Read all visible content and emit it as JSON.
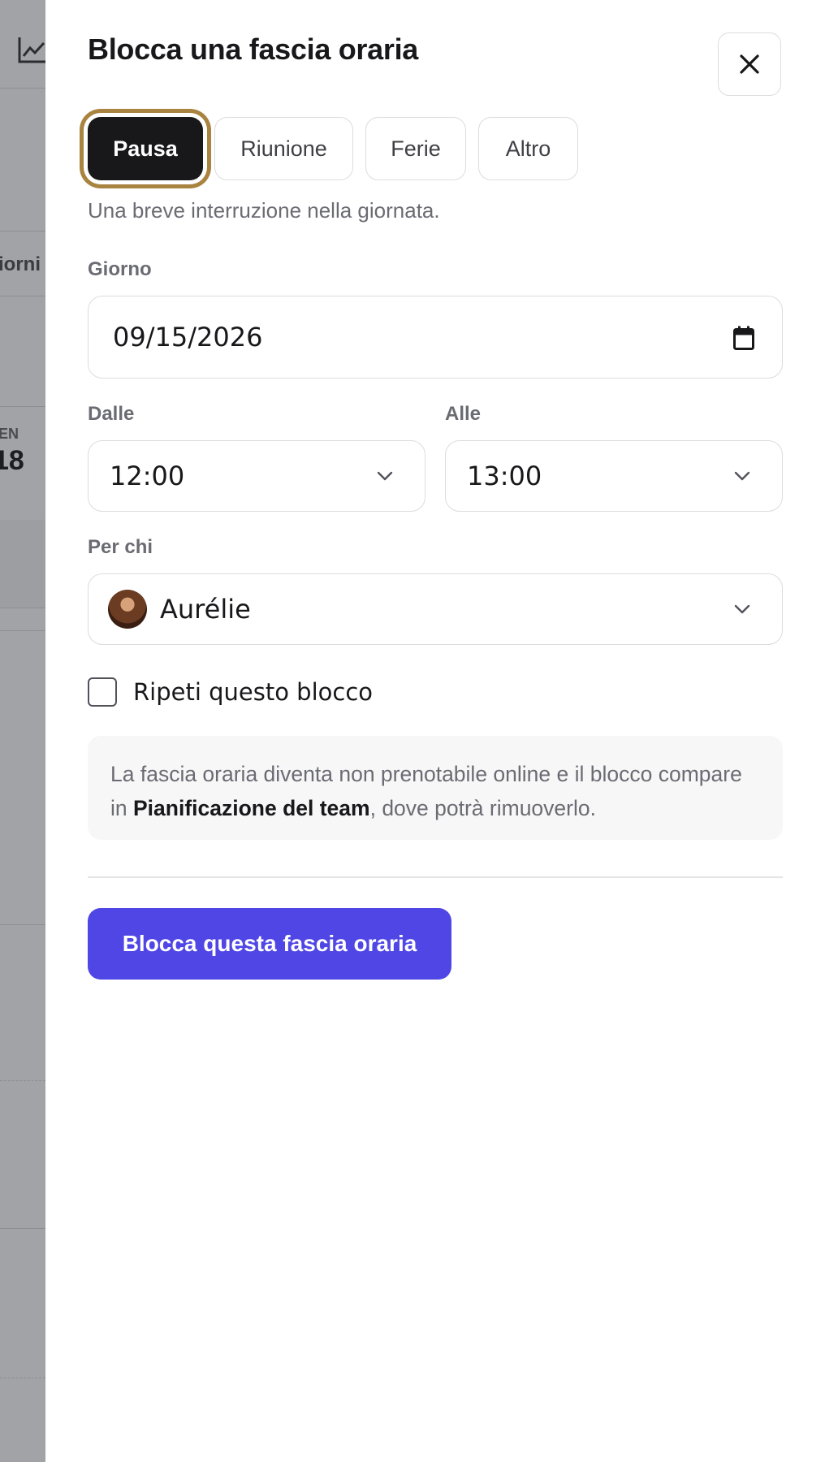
{
  "background": {
    "partial_label": "iorni",
    "day_abbrev": "EN",
    "day_number": "18"
  },
  "dialog": {
    "title": "Blocca una fascia oraria",
    "close_icon": "close-icon",
    "types": [
      {
        "label": "Pausa",
        "selected": true
      },
      {
        "label": "Riunione",
        "selected": false
      },
      {
        "label": "Ferie",
        "selected": false
      },
      {
        "label": "Altro",
        "selected": false
      }
    ],
    "type_description": "Una breve interruzione nella giornata.",
    "day": {
      "label": "Giorno",
      "value": "09/15/2026",
      "icon": "calendar-icon"
    },
    "from": {
      "label": "Dalle",
      "value": "12:00"
    },
    "to": {
      "label": "Alle",
      "value": "13:00"
    },
    "for_whom": {
      "label": "Per chi",
      "value": "Aurélie"
    },
    "repeat": {
      "label": "Ripeti questo blocco",
      "checked": false
    },
    "info": {
      "text_before": "La fascia oraria diventa non prenotabile online e il blocco compare in ",
      "bold": "Pianificazione del team",
      "text_after": ", dove potrà rimuoverlo."
    },
    "submit_label": "Blocca questa fascia oraria",
    "colors": {
      "accent": "#4f46e5",
      "active_tab": "#18181b",
      "focus_ring": "#a88440"
    }
  }
}
